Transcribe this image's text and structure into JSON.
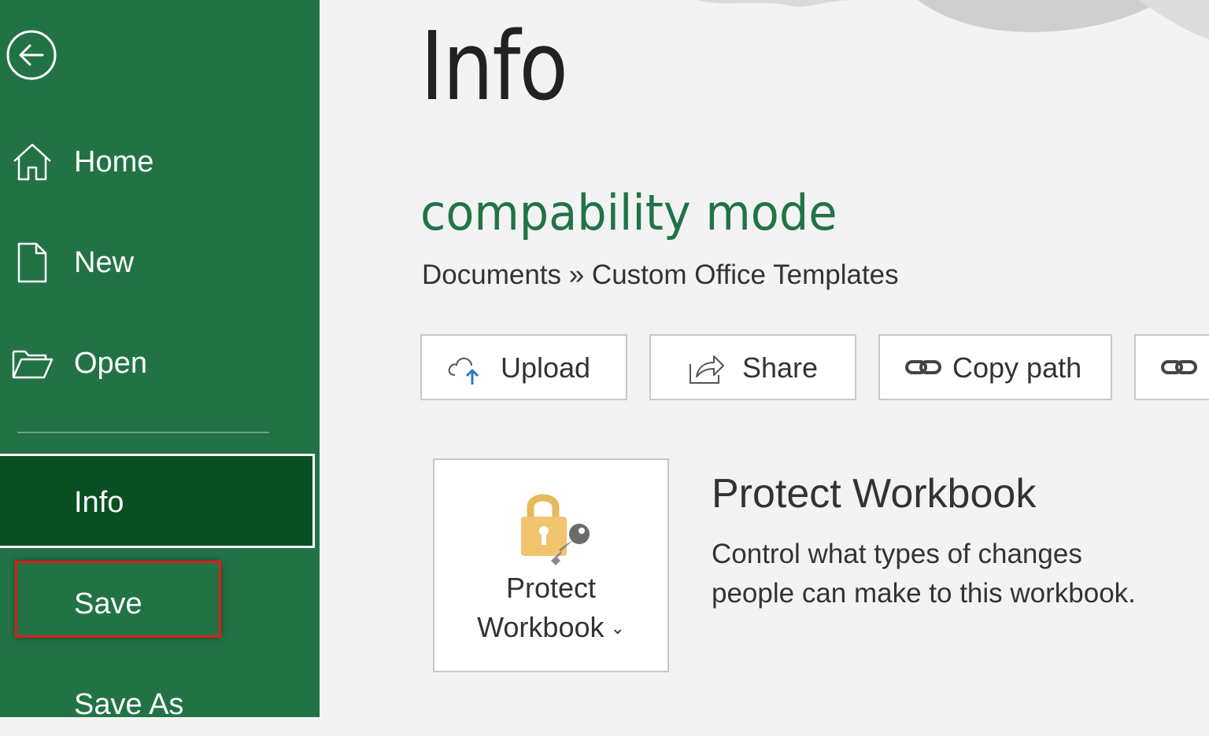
{
  "nav": {
    "back_label": "",
    "items": [
      {
        "label": "Home",
        "icon": "home-icon"
      },
      {
        "label": "New",
        "icon": "new-document-icon"
      },
      {
        "label": "Open",
        "icon": "open-folder-icon"
      }
    ],
    "info_label": "Info",
    "save_label": "Save",
    "save_as_label": "Save As"
  },
  "main": {
    "page_title": "Info",
    "doc_title": "compability mode",
    "breadcrumb": "Documents » Custom Office Templates",
    "actions": [
      {
        "label": "Upload",
        "icon": "cloud-upload-icon"
      },
      {
        "label": "Share",
        "icon": "share-icon"
      },
      {
        "label": "Copy path",
        "icon": "link-icon"
      },
      {
        "label": "",
        "icon": "link-icon"
      }
    ],
    "protect": {
      "button_line1": "Protect",
      "button_line2": "Workbook",
      "title": "Protect Workbook",
      "desc_line1": "Control what types of changes",
      "desc_line2": "people can make to this workbook."
    }
  },
  "colors": {
    "sidebar": "#217346",
    "selected": "#0a4f23",
    "highlight": "#e01c1c",
    "accent_text": "#217346"
  }
}
